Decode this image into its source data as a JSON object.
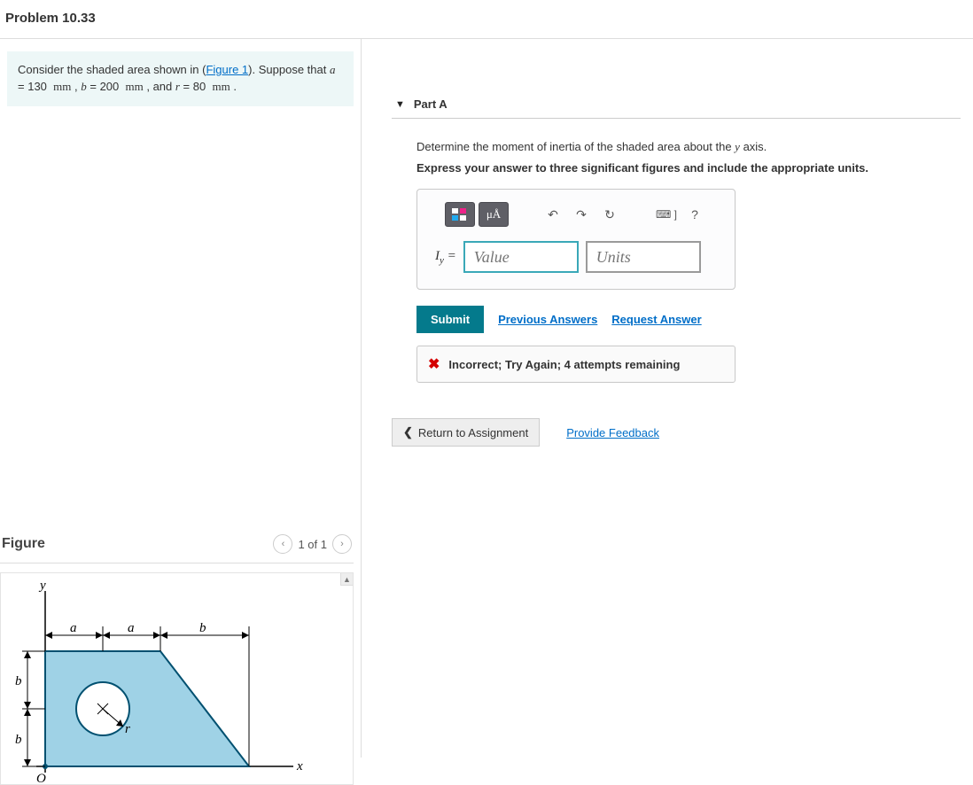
{
  "problem_title": "Problem 10.33",
  "prompt": {
    "prefix": "Consider the shaded area shown in (",
    "figure_link": "Figure 1",
    "suffix": "). Suppose that ",
    "a_var": "a",
    "a_val": "130",
    "a_unit": "mm",
    "b_var": "b",
    "b_val": "200",
    "b_unit": "mm",
    "r_var": "r",
    "r_val": "80",
    "r_unit": "mm"
  },
  "figure": {
    "heading": "Figure",
    "pager": "1 of 1",
    "labels": {
      "y": "y",
      "x": "x",
      "a": "a",
      "b": "b",
      "r": "r",
      "O": "O"
    }
  },
  "part": {
    "label": "Part A",
    "question_prefix": "Determine the moment of inertia of the shaded area about the ",
    "question_var": "y",
    "question_suffix": " axis.",
    "instruction": "Express your answer to three significant figures and include the appropriate units.",
    "lhs_symbol": "I",
    "lhs_sub": "y",
    "value_placeholder": "Value",
    "units_placeholder": "Units",
    "toolbar": {
      "templates_hint": "□/□",
      "units_hint": "μA",
      "undo": "↶",
      "redo": "↷",
      "reset": "↻",
      "keyboard": "⌨ ]",
      "help": "?"
    },
    "submit": "Submit",
    "prev_answers": "Previous Answers",
    "request_answer": "Request Answer",
    "feedback": "Incorrect; Try Again; 4 attempts remaining"
  },
  "footer": {
    "return": "Return to Assignment",
    "feedback_link": "Provide Feedback"
  }
}
